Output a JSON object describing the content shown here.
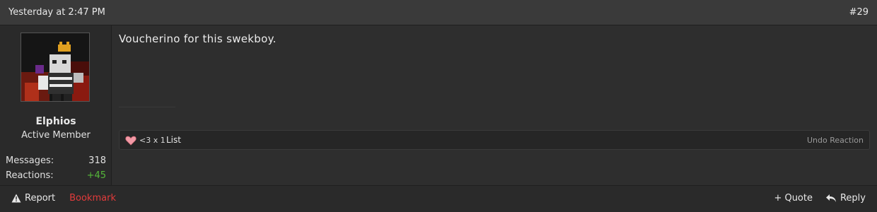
{
  "header": {
    "date": "Yesterday at 2:47 PM",
    "post_number": "#29"
  },
  "user": {
    "name": "Elphios",
    "title": "Active Member",
    "stats": [
      {
        "label": "Messages:",
        "value": "318"
      },
      {
        "label": "Reactions:",
        "value": "+45"
      }
    ]
  },
  "message": {
    "text": "Voucherino for this swekboy."
  },
  "reactions": {
    "summary": "<3 x 1",
    "list_label": "List",
    "undo_label": "Undo Reaction"
  },
  "footer": {
    "report": "Report",
    "bookmark": "Bookmark",
    "quote": "+ Quote",
    "reply": "Reply"
  },
  "colors": {
    "positive": "#55b83a",
    "bookmark": "#e23b3b"
  },
  "icons": {
    "report": "warning-icon",
    "reply": "reply-arrow-icon",
    "reaction": "heart-icon"
  }
}
